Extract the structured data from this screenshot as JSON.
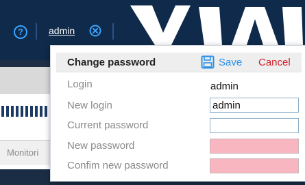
{
  "header": {
    "help_icon_glyph": "?",
    "user_link": "admin",
    "logout_icon": "close-circle-icon",
    "accent": "#3aa3ff",
    "background": "#0f2a4a"
  },
  "background_page": {
    "tab_label": "Monitori"
  },
  "popup": {
    "title": "Change password",
    "save_label": "Save",
    "save_icon": "floppy-disk-icon",
    "cancel_label": "Cancel",
    "save_color": "#2b90e8",
    "cancel_color": "#d0202a",
    "invalid_field_color": "#f8b6c0",
    "rows": {
      "login": {
        "label": "Login",
        "value": "admin"
      },
      "new_login": {
        "label": "New login",
        "value": "admin"
      },
      "current_password": {
        "label": "Current password",
        "value": ""
      },
      "new_password": {
        "label": "New password",
        "value": ""
      },
      "confirm_password": {
        "label": "Confim new password",
        "value": ""
      }
    }
  }
}
